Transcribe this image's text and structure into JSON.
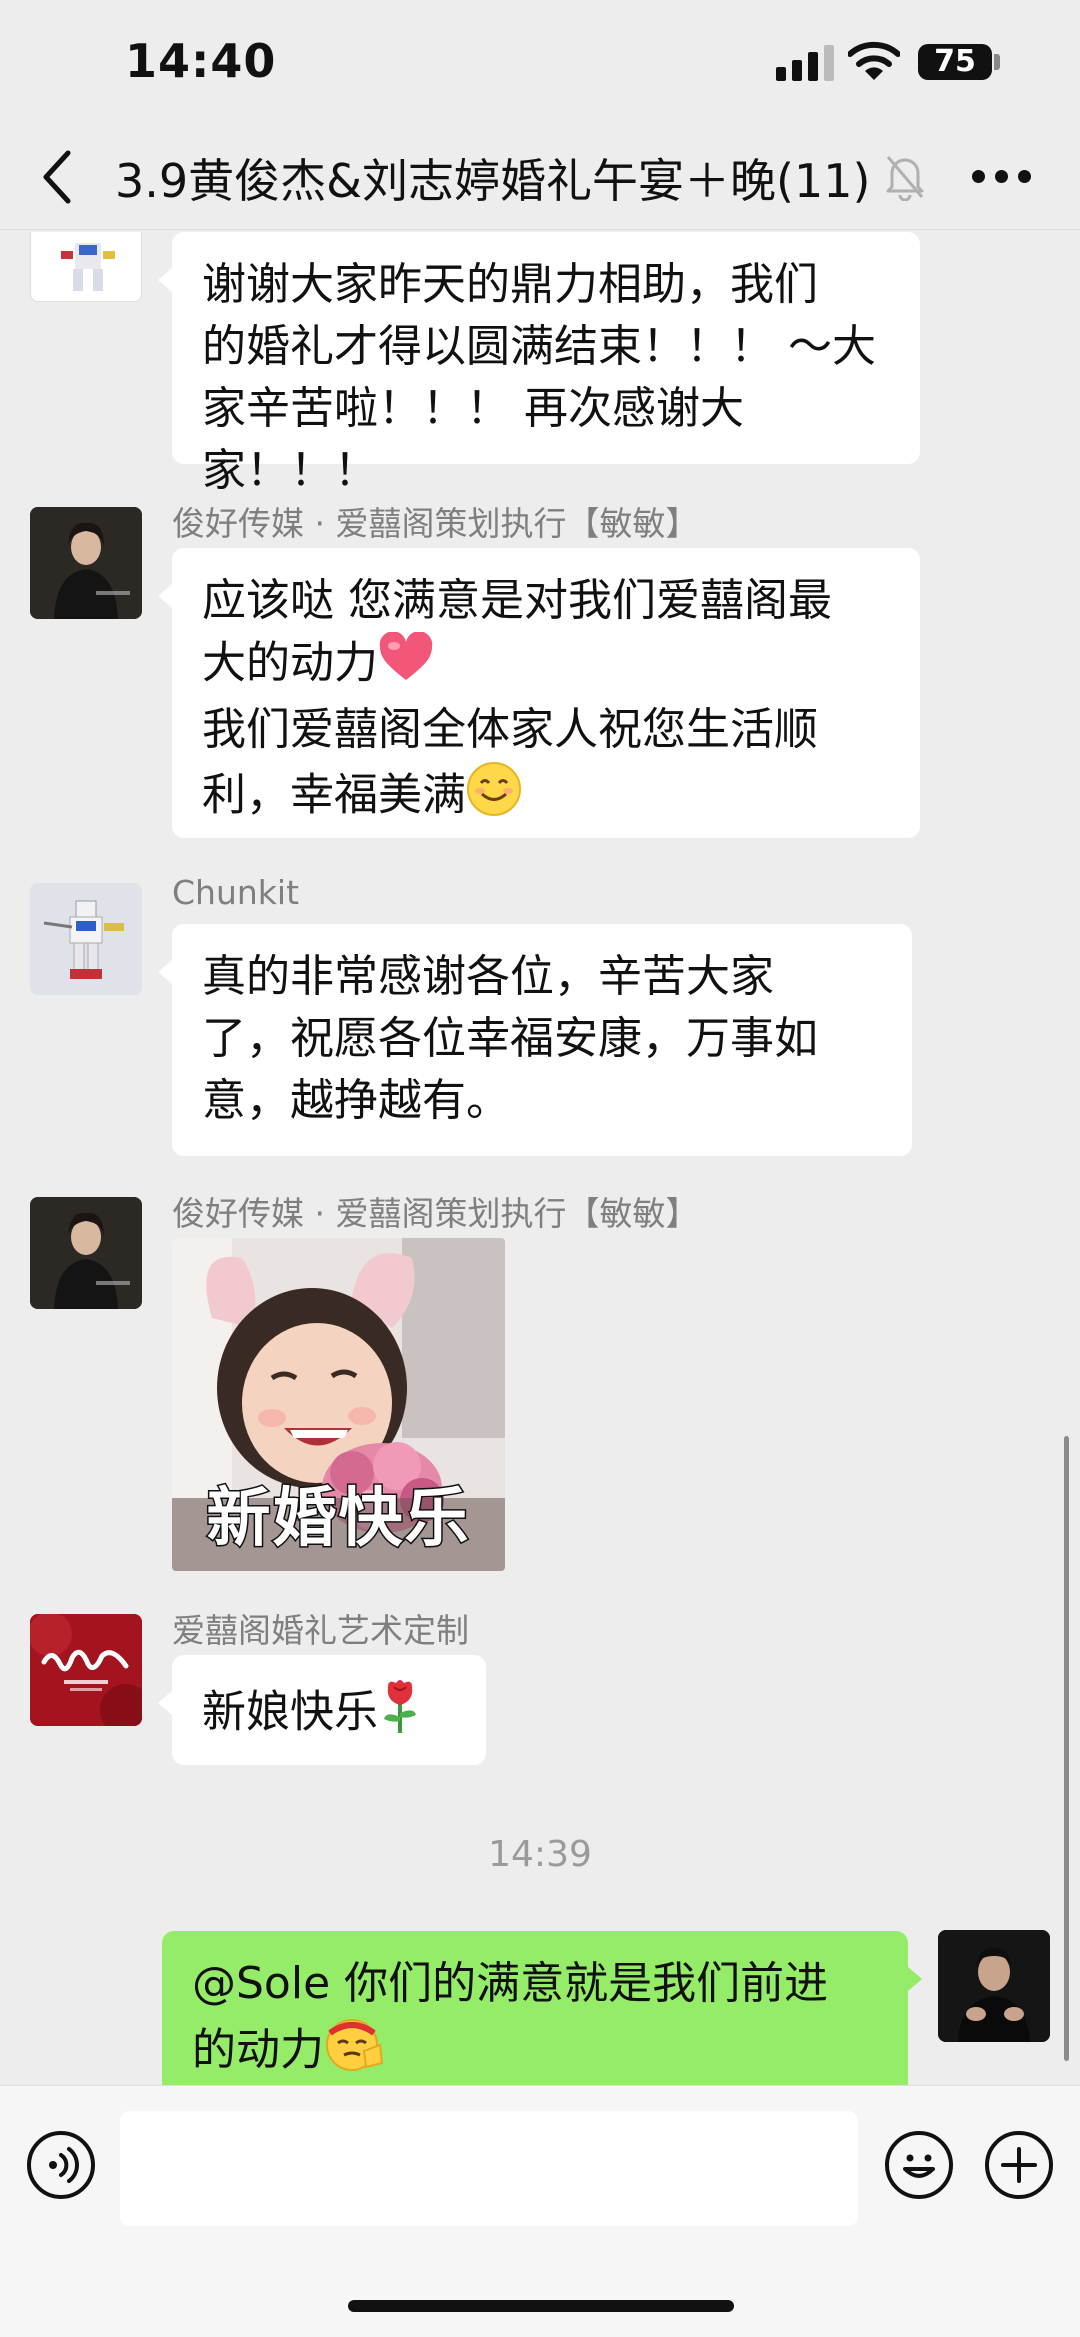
{
  "status_bar": {
    "time": "14:40",
    "battery": "75"
  },
  "nav": {
    "title": "3.9黄俊杰&刘志婷婚礼午宴＋晚",
    "member_count": "(11)"
  },
  "messages": [
    {
      "sender": "",
      "lines": [
        "谢谢大家昨天的鼎力相助，我们",
        "的婚礼才得以圆满结束！！！ ～大",
        "家辛苦啦！！！ 再次感谢大家！！！"
      ]
    },
    {
      "sender": "俊好传媒 · 爱囍阁策划执行【敏敏】",
      "lines": [
        "应该哒 您满意是对我们爱囍阁最",
        "大的动力",
        "我们爱囍阁全体家人祝您生活顺",
        "利，幸福美满"
      ]
    },
    {
      "sender": "Chunkit",
      "lines": [
        "真的非常感谢各位，辛苦大家",
        "了，祝愿各位幸福安康，万事如",
        "意，越挣越有。"
      ]
    },
    {
      "sender": "俊好传媒 · 爱囍阁策划执行【敏敏】",
      "sticker_caption": "新婚快乐"
    },
    {
      "sender": "爱囍阁婚礼艺术定制",
      "text": "新娘快乐"
    },
    {
      "time_divider": "14:39"
    },
    {
      "lines": [
        "@Sole 你们的满意就是我们前进",
        "的动力"
      ]
    }
  ],
  "icons": {
    "back": "chevron-left-icon",
    "mute": "bell-slash-icon",
    "more": "more-dots-icon",
    "voice": "voice-icon",
    "emoji": "emoji-icon",
    "plus": "plus-icon",
    "heart": "heart-emoji-icon",
    "smile": "smile-emoji-icon",
    "rose": "rose-emoji-icon",
    "salute": "salute-emoji-icon"
  },
  "colors": {
    "background": "#ededed",
    "my_bubble": "#95ec69",
    "other_bubble": "#ffffff"
  }
}
